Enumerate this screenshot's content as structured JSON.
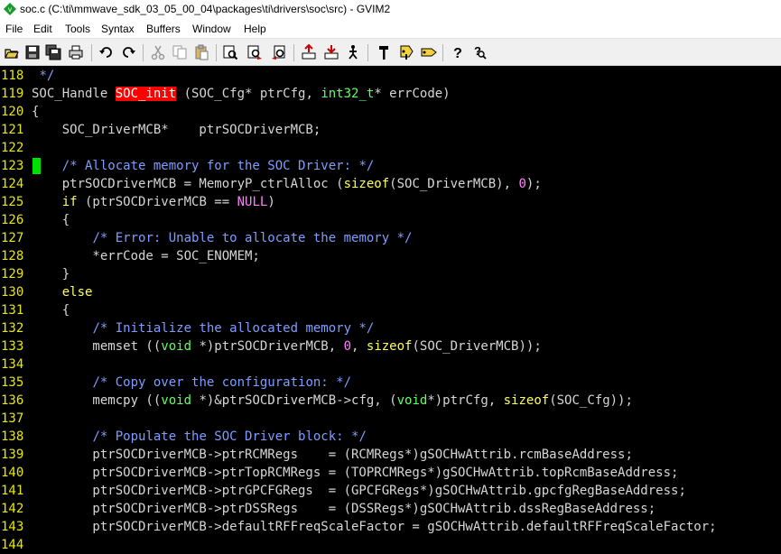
{
  "window": {
    "title": "soc.c (C:\\ti\\mmwave_sdk_03_05_00_04\\packages\\ti\\drivers\\soc\\src) - GVIM2"
  },
  "menu": [
    "File",
    "Edit",
    "Tools",
    "Syntax",
    "Buffers",
    "Window",
    "Help"
  ],
  "toolbar": {
    "buttons": [
      "open-icon",
      "save-icon",
      "save-all-icon",
      "print-icon",
      "undo-icon",
      "redo-icon",
      "cut-icon",
      "copy-icon",
      "paste-icon",
      "find-replace-icon",
      "find-next-icon",
      "find-prev-icon",
      "load-session-icon",
      "save-session-icon",
      "run-script-icon",
      "make-icon",
      "build-tags-icon",
      "tag-jump-icon",
      "help-icon",
      "find-help-icon"
    ]
  },
  "colors": {
    "editor_bg": "#000000",
    "line_number": "#e8e800",
    "comment": "#7f9dff",
    "type": "#60ff60",
    "keyword": "#ffff60",
    "number": "#ff80ff",
    "highlight_bg": "#ff0000",
    "cursor": "#00e000"
  },
  "editor": {
    "lines": [
      {
        "num": "118",
        "segments": [
          {
            "t": " ",
            "c": ""
          },
          {
            "t": "*/",
            "c": "comment"
          }
        ]
      },
      {
        "num": "119",
        "segments": [
          {
            "t": "SOC_Handle ",
            "c": ""
          },
          {
            "t": "SOC_init",
            "c": "hl"
          },
          {
            "t": " (SOC_Cfg* ptrCfg, ",
            "c": ""
          },
          {
            "t": "int32_t",
            "c": "type"
          },
          {
            "t": "* errCode)",
            "c": ""
          }
        ]
      },
      {
        "num": "120",
        "segments": [
          {
            "t": "{",
            "c": ""
          }
        ]
      },
      {
        "num": "121",
        "segments": [
          {
            "t": "    SOC_DriverMCB*    ptrSOCDriverMCB;",
            "c": ""
          }
        ]
      },
      {
        "num": "122",
        "segments": []
      },
      {
        "num": "123",
        "cursor": true,
        "segments": [
          {
            "t": "    ",
            "c": ""
          },
          {
            "t": "/* Allocate memory for the SOC Driver: */",
            "c": "comment"
          }
        ]
      },
      {
        "num": "124",
        "segments": [
          {
            "t": "    ptrSOCDriverMCB = MemoryP_ctrlAlloc (",
            "c": ""
          },
          {
            "t": "sizeof",
            "c": "kw"
          },
          {
            "t": "(SOC_DriverMCB), ",
            "c": ""
          },
          {
            "t": "0",
            "c": "num"
          },
          {
            "t": ");",
            "c": ""
          }
        ]
      },
      {
        "num": "125",
        "segments": [
          {
            "t": "    ",
            "c": ""
          },
          {
            "t": "if",
            "c": "kw"
          },
          {
            "t": " (ptrSOCDriverMCB == ",
            "c": ""
          },
          {
            "t": "NULL",
            "c": "num"
          },
          {
            "t": ")",
            "c": ""
          }
        ]
      },
      {
        "num": "126",
        "segments": [
          {
            "t": "    {",
            "c": ""
          }
        ]
      },
      {
        "num": "127",
        "segments": [
          {
            "t": "        ",
            "c": ""
          },
          {
            "t": "/* Error: Unable to allocate the memory */",
            "c": "comment"
          }
        ]
      },
      {
        "num": "128",
        "segments": [
          {
            "t": "        *errCode = SOC_ENOMEM;",
            "c": ""
          }
        ]
      },
      {
        "num": "129",
        "segments": [
          {
            "t": "    }",
            "c": ""
          }
        ]
      },
      {
        "num": "130",
        "segments": [
          {
            "t": "    ",
            "c": ""
          },
          {
            "t": "else",
            "c": "kw"
          }
        ]
      },
      {
        "num": "131",
        "segments": [
          {
            "t": "    {",
            "c": ""
          }
        ]
      },
      {
        "num": "132",
        "segments": [
          {
            "t": "        ",
            "c": ""
          },
          {
            "t": "/* Initialize the allocated memory */",
            "c": "comment"
          }
        ]
      },
      {
        "num": "133",
        "segments": [
          {
            "t": "        memset ((",
            "c": ""
          },
          {
            "t": "void",
            "c": "type"
          },
          {
            "t": " *)ptrSOCDriverMCB, ",
            "c": ""
          },
          {
            "t": "0",
            "c": "num"
          },
          {
            "t": ", ",
            "c": ""
          },
          {
            "t": "sizeof",
            "c": "kw"
          },
          {
            "t": "(SOC_DriverMCB));",
            "c": ""
          }
        ]
      },
      {
        "num": "134",
        "segments": []
      },
      {
        "num": "135",
        "segments": [
          {
            "t": "        ",
            "c": ""
          },
          {
            "t": "/* Copy over the configuration: */",
            "c": "comment"
          }
        ]
      },
      {
        "num": "136",
        "segments": [
          {
            "t": "        memcpy ((",
            "c": ""
          },
          {
            "t": "void",
            "c": "type"
          },
          {
            "t": " *)&ptrSOCDriverMCB->cfg, (",
            "c": ""
          },
          {
            "t": "void",
            "c": "type"
          },
          {
            "t": "*)ptrCfg, ",
            "c": ""
          },
          {
            "t": "sizeof",
            "c": "kw"
          },
          {
            "t": "(SOC_Cfg));",
            "c": ""
          }
        ]
      },
      {
        "num": "137",
        "segments": []
      },
      {
        "num": "138",
        "segments": [
          {
            "t": "        ",
            "c": ""
          },
          {
            "t": "/* Populate the SOC Driver block: */",
            "c": "comment"
          }
        ]
      },
      {
        "num": "139",
        "segments": [
          {
            "t": "        ptrSOCDriverMCB->ptrRCMRegs    = (RCMRegs*)gSOCHwAttrib.rcmBaseAddress;",
            "c": ""
          }
        ]
      },
      {
        "num": "140",
        "segments": [
          {
            "t": "        ptrSOCDriverMCB->ptrTopRCMRegs = (TOPRCMRegs*)gSOCHwAttrib.topRcmBaseAddress;",
            "c": ""
          }
        ]
      },
      {
        "num": "141",
        "segments": [
          {
            "t": "        ptrSOCDriverMCB->ptrGPCFGRegs  = (GPCFGRegs*)gSOCHwAttrib.gpcfgRegBaseAddress;",
            "c": ""
          }
        ]
      },
      {
        "num": "142",
        "segments": [
          {
            "t": "        ptrSOCDriverMCB->ptrDSSRegs    = (DSSRegs*)gSOCHwAttrib.dssRegBaseAddress;",
            "c": ""
          }
        ]
      },
      {
        "num": "143",
        "segments": [
          {
            "t": "        ptrSOCDriverMCB->defaultRFFreqScaleFactor = gSOCHwAttrib.defaultRFFreqScaleFactor;",
            "c": ""
          }
        ]
      },
      {
        "num": "144",
        "segments": []
      }
    ]
  }
}
